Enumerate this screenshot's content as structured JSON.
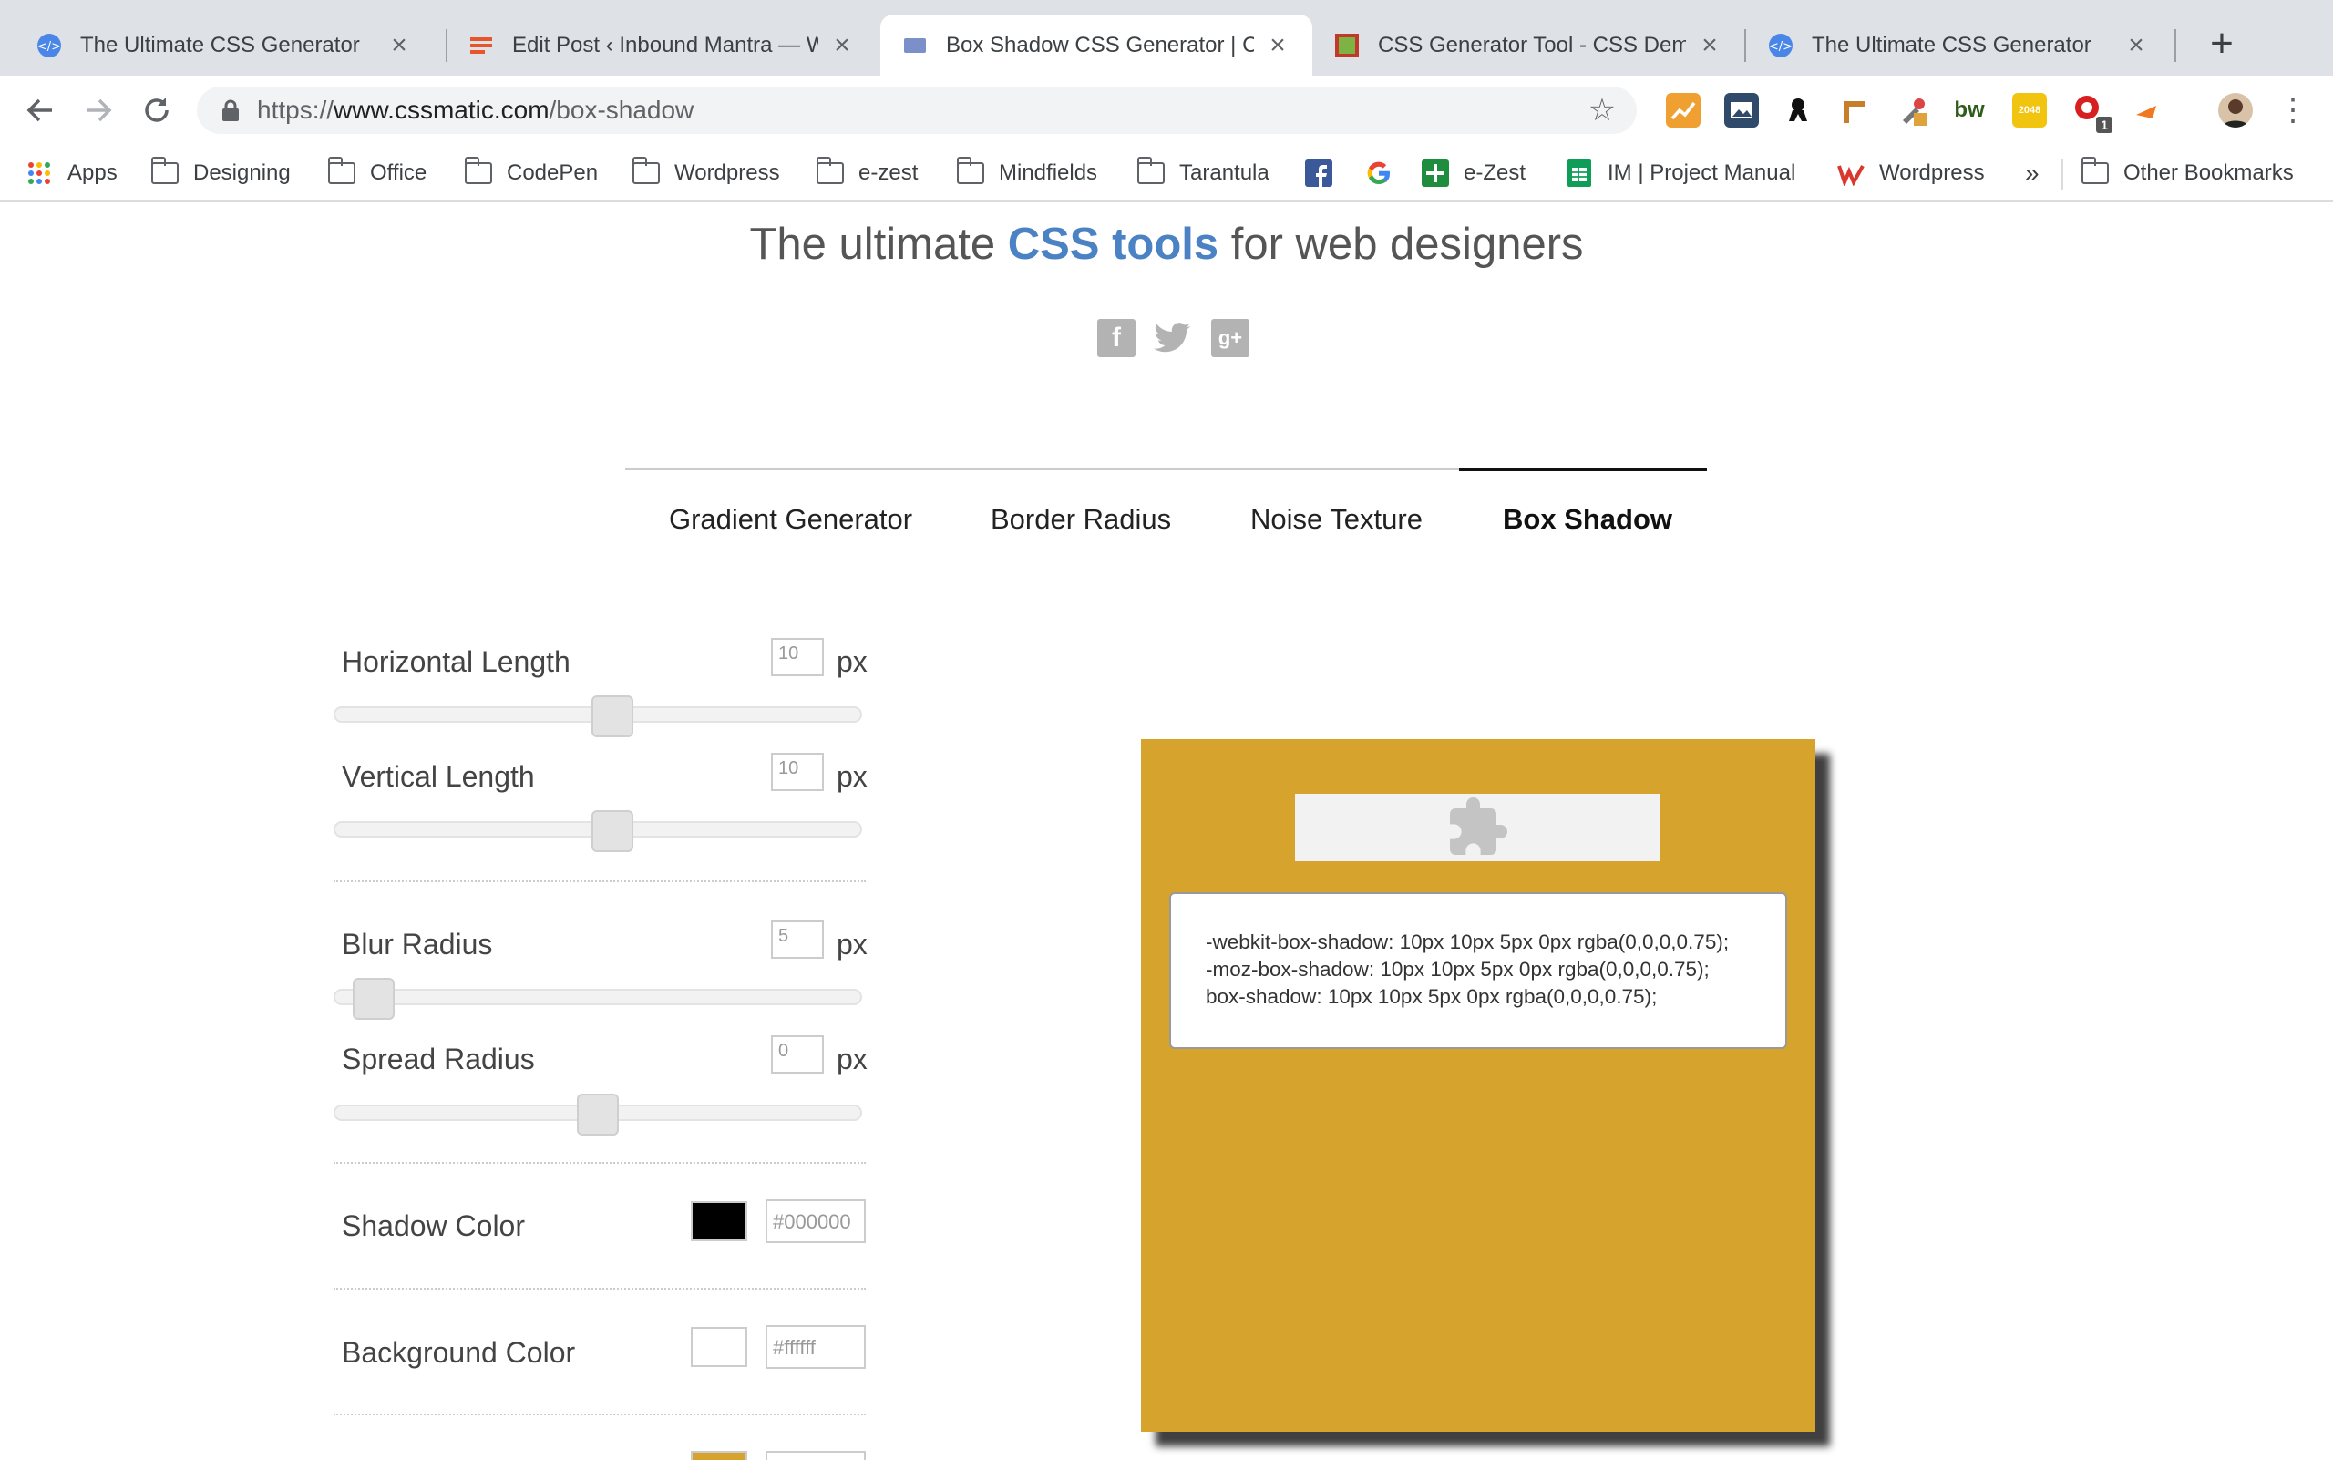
{
  "browser": {
    "tabs": [
      {
        "title": "The Ultimate CSS Generator",
        "active": false
      },
      {
        "title": "Edit Post ‹ Inbound Mantra — W",
        "active": false
      },
      {
        "title": "Box Shadow CSS Generator | C",
        "active": true
      },
      {
        "title": "CSS Generator Tool - CSS Dem",
        "active": false
      },
      {
        "title": "The Ultimate CSS Generator",
        "active": false
      }
    ],
    "url": {
      "scheme": "https://",
      "host": "www.cssmatic.com",
      "path": "/box-shadow"
    },
    "bookmarks": [
      "Apps",
      "Designing",
      "Office",
      "CodePen",
      "Wordpress",
      "e-zest",
      "Mindfields",
      "Tarantula",
      "e-Zest",
      "IM | Project Manual",
      "Wordpress"
    ],
    "other_bookmarks": "Other Bookmarks",
    "overflow": "»",
    "extension_badge": "1",
    "ext_bw_label": "bw",
    "ext_2048_label": "2048"
  },
  "page": {
    "headline_pre": "The ultimate ",
    "headline_accent": "CSS tools",
    "headline_post": " for web designers",
    "social": [
      "facebook-icon",
      "twitter-icon",
      "google-plus-icon"
    ],
    "social_glyphs": {
      "facebook": "f",
      "google_plus": "g+"
    },
    "nav": [
      {
        "label": "Gradient Generator",
        "active": false
      },
      {
        "label": "Border Radius",
        "active": false
      },
      {
        "label": "Noise Texture",
        "active": false
      },
      {
        "label": "Box Shadow",
        "active": true
      }
    ],
    "unit": "px",
    "controls": {
      "horizontal": {
        "label": "Horizontal Length",
        "value": "10",
        "level": 0.53
      },
      "vertical": {
        "label": "Vertical Length",
        "value": "10",
        "level": 0.53
      },
      "blur": {
        "label": "Blur Radius",
        "value": "5",
        "level": 0.04
      },
      "spread": {
        "label": "Spread Radius",
        "value": "0",
        "level": 0.5
      },
      "shadow_color": {
        "label": "Shadow Color",
        "value": "#000000",
        "swatch": "#000000"
      },
      "background_color": {
        "label": "Background Color",
        "value": "#ffffff",
        "swatch": "#ffffff"
      }
    },
    "preview": {
      "box_color": "#d6a32d",
      "code": [
        "-webkit-box-shadow: 10px 10px 5px 0px rgba(0,0,0,0.75);",
        "-moz-box-shadow: 10px 10px 5px 0px rgba(0,0,0,0.75);",
        "box-shadow: 10px 10px 5px 0px rgba(0,0,0,0.75);"
      ]
    }
  }
}
